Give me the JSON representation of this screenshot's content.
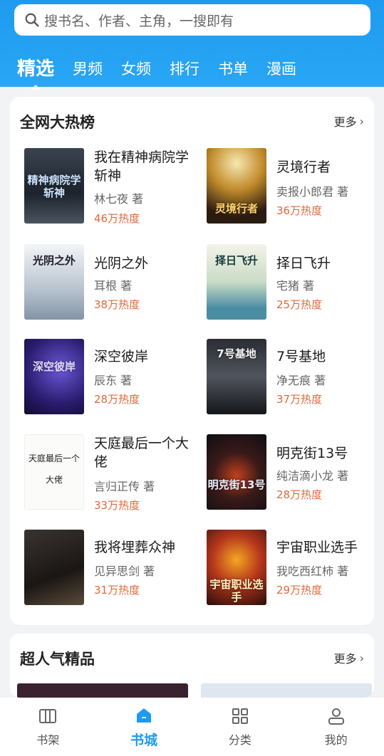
{
  "search": {
    "placeholder": "搜书名、作者、主角，一搜即有"
  },
  "tabs": [
    {
      "label": "精选",
      "active": true
    },
    {
      "label": "男频"
    },
    {
      "label": "女频"
    },
    {
      "label": "排行"
    },
    {
      "label": "书单"
    },
    {
      "label": "漫画"
    }
  ],
  "section1": {
    "title": "全网大热榜",
    "more": "更多",
    "books": [
      {
        "title": "我在精神病院学斩神",
        "cover_text": "精神病院学斩神",
        "author": "林七夜 著",
        "heat": "46万热度"
      },
      {
        "title": "灵境行者",
        "cover_text": "灵境行者",
        "author": "卖报小郎君 著",
        "heat": "36万热度"
      },
      {
        "title": "光阴之外",
        "cover_text": "光阴之外",
        "author": "耳根 著",
        "heat": "38万热度"
      },
      {
        "title": "择日飞升",
        "cover_text": "择日飞升",
        "author": "宅猪 著",
        "heat": "25万热度"
      },
      {
        "title": "深空彼岸",
        "cover_text": "深空彼岸",
        "author": "辰东 著",
        "heat": "28万热度"
      },
      {
        "title": "7号基地",
        "cover_text": "7号基地",
        "author": "净无痕 著",
        "heat": "37万热度"
      },
      {
        "title": "天庭最后一个大佬",
        "cover_text": "天庭最后一个大佬",
        "author": "言归正传 著",
        "heat": "33万热度"
      },
      {
        "title": "明克街13号",
        "cover_text": "明克街13号",
        "author": "纯洁滴小龙 著",
        "heat": "28万热度"
      },
      {
        "title": "我将埋葬众神",
        "cover_text": "",
        "author": "见异思剑 著",
        "heat": "31万热度"
      },
      {
        "title": "宇宙职业选手",
        "cover_text": "宇宙职业选手",
        "author": "我吃西红柿 著",
        "heat": "29万热度"
      }
    ]
  },
  "section2": {
    "title": "超人气精品",
    "more": "更多"
  },
  "bottom_nav": [
    {
      "label": "书架",
      "icon": "bookshelf-icon"
    },
    {
      "label": "书城",
      "icon": "bookstore-home-icon",
      "active": true
    },
    {
      "label": "分类",
      "icon": "category-grid-icon"
    },
    {
      "label": "我的",
      "icon": "profile-icon"
    }
  ],
  "colors": {
    "accent": "#1e9bef",
    "heat": "#e2683a"
  }
}
